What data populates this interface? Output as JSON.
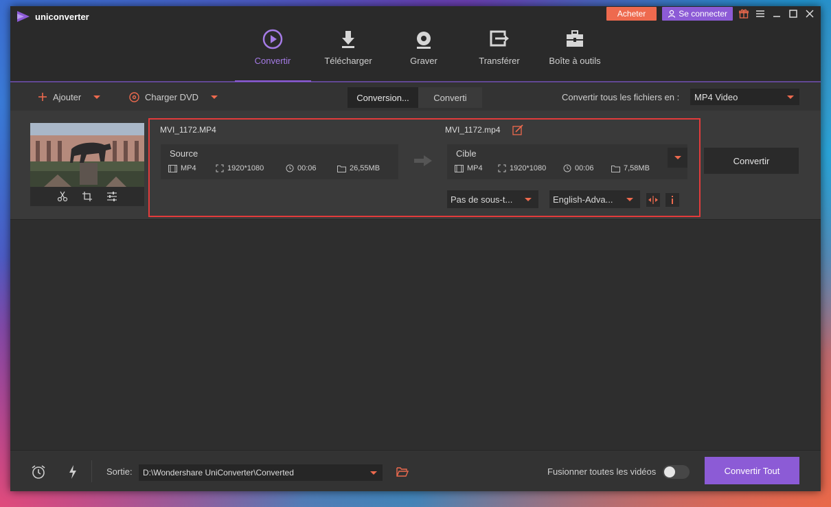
{
  "app": {
    "title": "uniconverter",
    "buy_label": "Acheter",
    "login_label": "Se connecter"
  },
  "nav": {
    "items": [
      {
        "label": "Convertir",
        "icon": "play-circle-icon",
        "active": true
      },
      {
        "label": "Télécharger",
        "icon": "download-icon",
        "active": false
      },
      {
        "label": "Graver",
        "icon": "disc-icon",
        "active": false
      },
      {
        "label": "Transférer",
        "icon": "transfer-icon",
        "active": false
      },
      {
        "label": "Boîte à outils",
        "icon": "toolbox-icon",
        "active": false
      }
    ]
  },
  "toolbar": {
    "add_label": "Ajouter",
    "load_dvd_label": "Charger DVD",
    "tab_converting": "Conversion...",
    "tab_converted": "Converti",
    "convert_all_label": "Convertir tous les fichiers en :",
    "format_value": "MP4 Video"
  },
  "file": {
    "source_name": "MVI_1172.MP4",
    "target_name": "MVI_1172.mp4",
    "source": {
      "title": "Source",
      "format": "MP4",
      "resolution": "1920*1080",
      "duration": "00:06",
      "size": "26,55MB"
    },
    "target": {
      "title": "Cible",
      "format": "MP4",
      "resolution": "1920*1080",
      "duration": "00:06",
      "size": "7,58MB"
    },
    "subtitle_value": "Pas de sous-t...",
    "audio_value": "English-Adva...",
    "convert_label": "Convertir"
  },
  "footer": {
    "output_label": "Sortie:",
    "output_path": "D:\\Wondershare UniConverter\\Converted",
    "merge_label": "Fusionner toutes les vidéos",
    "merge_on": false,
    "convert_all_button": "Convertir Tout"
  },
  "colors": {
    "accent": "#8c5bd6",
    "buy": "#ee6a4e",
    "highlight": "#e33b3b"
  }
}
